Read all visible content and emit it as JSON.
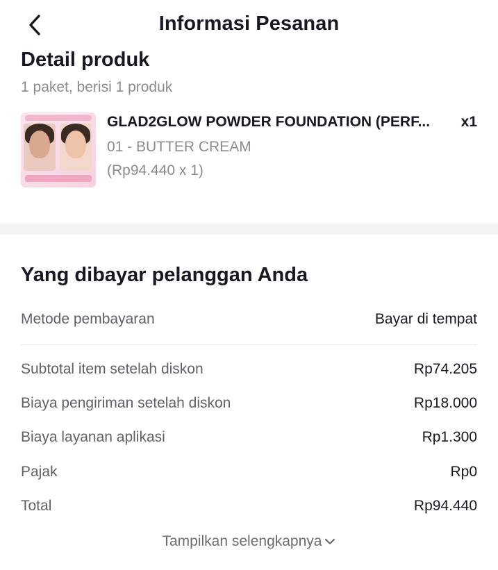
{
  "header": {
    "title": "Informasi Pesanan",
    "back_icon": "chevron-left-icon"
  },
  "product_detail": {
    "title": "Detail produk",
    "package_info": "1 paket, berisi 1 produk",
    "product": {
      "name": "GLAD2GLOW POWDER FOUNDATION (PERF...",
      "quantity": "x1",
      "variant": "01 - BUTTER CREAM",
      "price": "(Rp94.440 x 1)"
    }
  },
  "payment": {
    "title": "Yang dibayar pelanggan Anda",
    "method": {
      "label": "Metode pembayaran",
      "value": "Bayar di tempat"
    },
    "rows": [
      {
        "label": "Subtotal item setelah diskon",
        "value": "Rp74.205"
      },
      {
        "label": "Biaya pengiriman setelah diskon",
        "value": "Rp18.000"
      },
      {
        "label": "Biaya layanan aplikasi",
        "value": "Rp1.300"
      },
      {
        "label": "Pajak",
        "value": "Rp0"
      },
      {
        "label": "Total",
        "value": "Rp94.440"
      }
    ],
    "show_more": "Tampilkan selengkapnya",
    "show_more_icon": "chevron-down-icon"
  }
}
